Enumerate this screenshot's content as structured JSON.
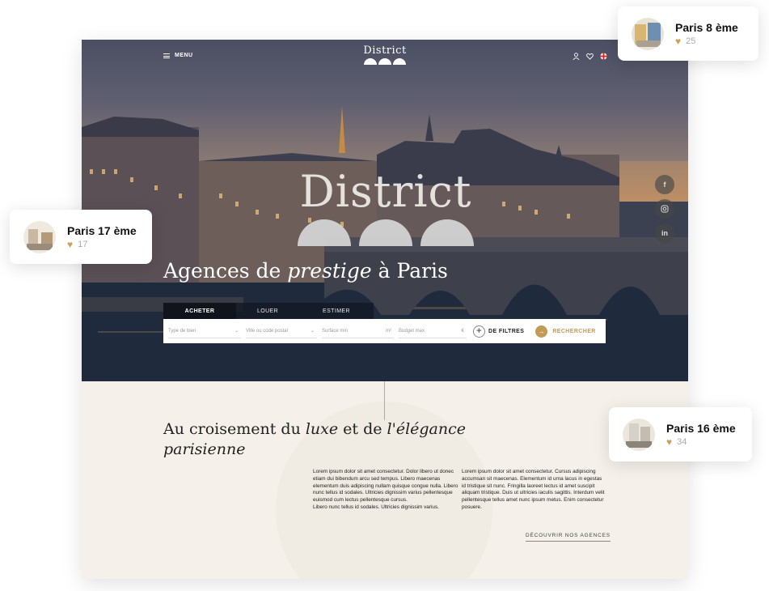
{
  "header": {
    "menu_label": "MENU",
    "logo_text": "District"
  },
  "hero": {
    "logo_text": "District",
    "title_before": "Agences de ",
    "title_em": "prestige",
    "title_after": " à Paris",
    "social": [
      "facebook-icon",
      "instagram-icon",
      "linkedin-icon"
    ]
  },
  "search": {
    "tabs": [
      "ACHETER",
      "LOUER",
      "ESTIMER"
    ],
    "active_tab": "ACHETER",
    "fields": [
      {
        "placeholder": "Type de bien",
        "suffix": "⌄"
      },
      {
        "placeholder": "Ville ou code postal",
        "suffix": "⌄"
      },
      {
        "placeholder": "Surface min",
        "suffix": "m²"
      },
      {
        "placeholder": "Budget max",
        "suffix": "€"
      }
    ],
    "filters_label": "DE FILTRES",
    "search_label": "RECHERCHER"
  },
  "about": {
    "title_l1_a": "Au croisement du ",
    "title_l1_em": "luxe",
    "title_l1_b": " et de ",
    "title_l1_em2": "l'élégance",
    "title_l2_em": "parisienne",
    "col1_p1": "Lorem ipsum dolor sit amet consectetur. Dolor libero ut donec etiam dui bibendum arcu sed tempus. Libero maecenas elementum duis adipiscing nullam quisque congue nulla. Libero nunc tellus id sodales. Ultricies dignissim varius pellentesque euismod cum lectus pellentesque cursus.",
    "col1_p2": "Libero nunc tellus id sodales. Ultricies dignissim varius.",
    "col2": "Lorem ipsum dolor sit amet consectetur. Cursus adipiscing accumsan sit maecenas. Elementum id urna lacus in egestas id tristique sit nunc. Fringilla laoreet lectus id amet suscipit aliquam tristique. Duis ut ultricies iaculis sagittis. Interdum velit pellentesque tellus amet nunc ipsum metus. Enim consectetur posuere.",
    "discover_label": "DÉCOUVRIR NOS AGENCES"
  },
  "cards": [
    {
      "name": "Paris 8 ème",
      "likes": "25"
    },
    {
      "name": "Paris 17 ème",
      "likes": "17"
    },
    {
      "name": "Paris 16 ème",
      "likes": "34"
    }
  ],
  "colors": {
    "accent": "#c39a56",
    "bg": "#f5f1ea",
    "heart": "#c9a15e"
  }
}
